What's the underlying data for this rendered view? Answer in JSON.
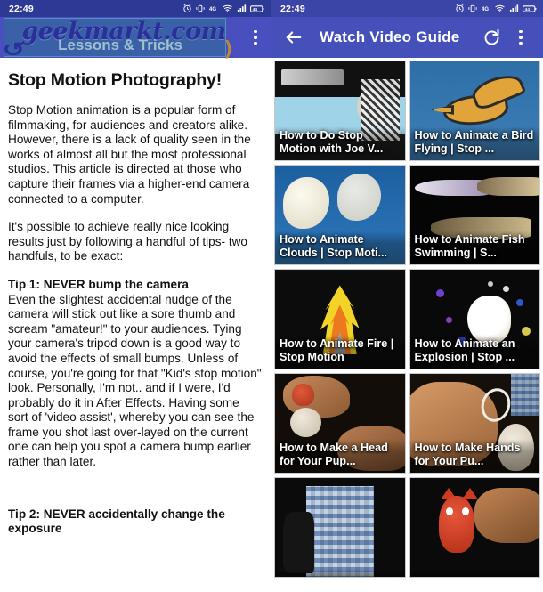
{
  "left_phone": {
    "statusbar": {
      "time": "22:49",
      "icons": [
        "alarm-icon",
        "vibrate-icon",
        "data-4g-icon",
        "wifi-icon",
        "signal-icon",
        "battery-icon"
      ]
    },
    "appbar": {
      "title": "Lessons & Tricks",
      "watermark": "geekmarkt.com",
      "overflow_label": "more-options"
    },
    "article": {
      "heading": "Stop Motion Photography!",
      "paragraph_1": "Stop Motion animation is a popular form of filmmaking, for audiences and creators alike. However, there is a lack of quality seen in the works of almost all but the most professional studios. This article is directed at those who capture their frames via a higher-end camera connected to a computer.",
      "paragraph_2": "It's possible to achieve really nice looking results just by following a handful of tips- two handfuls, to be exact:",
      "tip1_heading": "Tip 1: NEVER bump the camera",
      "tip1_body": "Even the slightest accidental nudge of the camera will stick out like a sore thumb and scream \"amateur!\" to your audiences. Tying your camera's tripod down is a good way to avoid the effects of small bumps. Unless of course, you're going for that \"Kid's stop motion\" look. Personally, I'm not.. and if I were, I'd probably do it in After Effects. Having some sort of 'video assist', whereby you can see the frame you shot last over-layed on the current one can help you spot a camera bump earlier rather than later.",
      "tip2_heading": "Tip 2: NEVER accidentally change the exposure"
    }
  },
  "right_phone": {
    "statusbar": {
      "time": "22:49",
      "icons": [
        "alarm-icon",
        "vibrate-icon",
        "data-4g-icon",
        "wifi-icon",
        "signal-icon",
        "battery-icon"
      ]
    },
    "appbar": {
      "back_label": "back-arrow",
      "title": "Watch Video Guide",
      "refresh_label": "refresh",
      "overflow_label": "more-options"
    },
    "videos": [
      {
        "title": "How to Do Stop Motion with Joe V...",
        "thumb": "th-joe"
      },
      {
        "title": "How to Animate a Bird Flying | Stop ...",
        "thumb": "th-bird"
      },
      {
        "title": "How to Animate Clouds | Stop Moti...",
        "thumb": "th-clouds"
      },
      {
        "title": "How to Animate Fish Swimming | S...",
        "thumb": "th-fish"
      },
      {
        "title": "How to Animate Fire | Stop Motion",
        "thumb": "th-fire"
      },
      {
        "title": "How to Animate an Explosion | Stop ...",
        "thumb": "th-expl"
      },
      {
        "title": "How to Make a Head for Your Pup...",
        "thumb": "th-head"
      },
      {
        "title": "How to Make Hands for Your Pu...",
        "thumb": "th-hands"
      },
      {
        "title": "",
        "thumb": "th-plaid2"
      },
      {
        "title": "",
        "thumb": "th-cat"
      }
    ]
  },
  "colors": {
    "left_statusbar": "#2c3a96",
    "left_appbar": "#4a4fc0",
    "right_statusbar": "#3b45a8",
    "right_appbar": "#4550bb",
    "watermark_text": "#2a2f9c",
    "page_background": "#ffffff"
  }
}
